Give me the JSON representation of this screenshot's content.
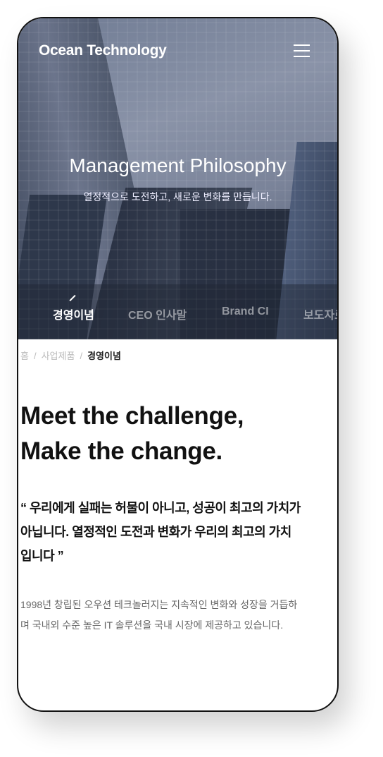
{
  "header": {
    "logo": "Ocean Technology",
    "menu_icon": "hamburger-icon"
  },
  "hero": {
    "title": "Management Philosophy",
    "subtitle": "열정적으로 도전하고, 새로운 변화를 만듭니다."
  },
  "tabs": [
    {
      "label": "경영이념",
      "active": true
    },
    {
      "label": "CEO 인사말"
    },
    {
      "label": "Brand CI"
    },
    {
      "label": "보도자료"
    }
  ],
  "breadcrumb": [
    "홈",
    "사업제품",
    "경영이념"
  ],
  "main": {
    "headline_1": "Meet the challenge,",
    "headline_2": "Make the change.",
    "quote": "“ 우리에게 실패는 허물이 아니고, 성공이 최고의 가치가 아닙니다. 열정적인 도전과 변화가 우리의 최고의 가치입니다 ”",
    "description": "1998년 창립된 오우션 테크놀러지는 지속적인 변화와 성장을 거듭하며 국내외 수준 높은 IT 솔루션을 국내 시장에 제공하고 있습니다."
  }
}
